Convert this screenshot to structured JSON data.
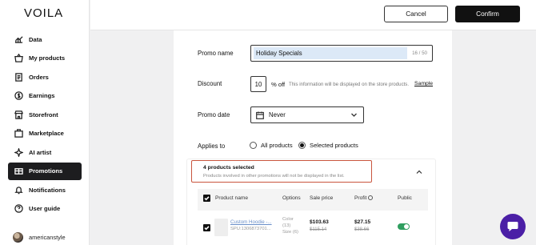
{
  "app": {
    "logo": "VOILA"
  },
  "sidebar": {
    "items": [
      {
        "label": "Data",
        "icon": "data-icon"
      },
      {
        "label": "My products",
        "icon": "basket-icon"
      },
      {
        "label": "Orders",
        "icon": "orders-icon"
      },
      {
        "label": "Earnings",
        "icon": "dollar-icon"
      },
      {
        "label": "Storefront",
        "icon": "storefront-icon"
      },
      {
        "label": "Marketplace",
        "icon": "marketplace-icon"
      },
      {
        "label": "AI artist",
        "icon": "sparkle-icon"
      },
      {
        "label": "Promotions",
        "icon": "promotions-icon",
        "active": true
      },
      {
        "label": "Notifications",
        "icon": "bell-icon"
      },
      {
        "label": "User guide",
        "icon": "help-icon"
      }
    ],
    "user": {
      "name": "americanstyle"
    }
  },
  "header": {
    "cancel_label": "Cancel",
    "confirm_label": "Confirm"
  },
  "form": {
    "promo_name": {
      "label": "Promo name",
      "value": "Holiday Specials",
      "counter": "16 / 50"
    },
    "discount": {
      "label": "Discount",
      "value": "10",
      "unit": "% off",
      "info": "This information will be displayed on the store products.",
      "sample_link": "Sample"
    },
    "promo_date": {
      "label": "Promo date",
      "value": "Never"
    },
    "applies_to": {
      "label": "Applies to",
      "option_all": "All products",
      "option_selected": "Selected products",
      "selected": "Selected products"
    }
  },
  "selection": {
    "title": "4 products selected",
    "subtitle": "Products involved in other promotions will not be displayed in the list."
  },
  "table": {
    "headers": {
      "name": "Product name",
      "options": "Options",
      "sale_price": "Sale price",
      "profit": "Profit",
      "public": "Public"
    },
    "rows": [
      {
        "name": "Custom Hoodie -...",
        "spu": "SPU:1306873701...",
        "options_color": "Color",
        "options_color_count": "(13)",
        "options_size": "Size (6)",
        "sale_price": "$103.63",
        "sale_price_old": "$115.14",
        "profit": "$27.15",
        "profit_old": "$38.66",
        "public": true
      }
    ]
  },
  "colors": {
    "accent": "#1d1d1f",
    "highlight_border": "#c9553e",
    "toggle_on": "#2f9e5f",
    "chat": "#4b1fa6"
  }
}
